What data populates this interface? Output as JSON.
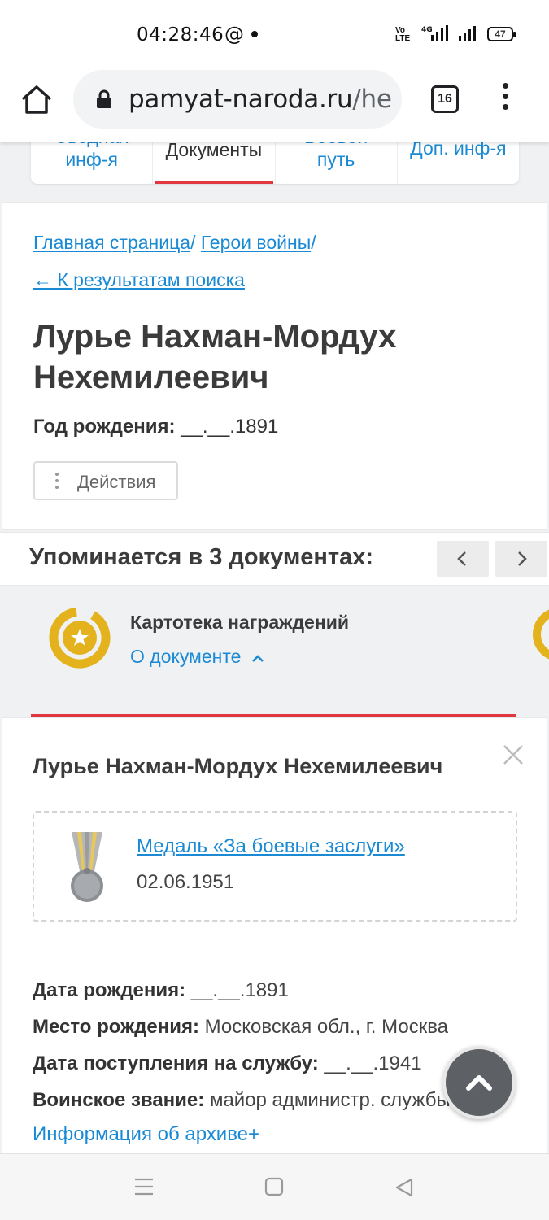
{
  "status": {
    "time": "04:28:46",
    "at_symbol": "@",
    "volte": "Vo\nLTE",
    "network": "4G",
    "battery": "47"
  },
  "browser": {
    "url_host": "pamyat-naroda.ru",
    "url_rest": "/he",
    "tab_count": "16"
  },
  "tabs": [
    {
      "line1": "Сводная",
      "line2": "инф-я"
    },
    {
      "label": "Документы"
    },
    {
      "line1": "Боевой",
      "line2": "путь"
    },
    {
      "label": "Доп. инф-я"
    }
  ],
  "breadcrumbs": {
    "home": "Главная страница",
    "heroes": "Герои войны",
    "separator": "/",
    "back": "← К результатам поиска"
  },
  "person": {
    "name": "Лурье Нахман-Мордух Нехемилеевич",
    "birth_label": "Год рождения:",
    "birth_value": "__.__.1891"
  },
  "actions_label": "Действия",
  "mentions": {
    "title": "Упоминается в 3 документах:"
  },
  "document": {
    "title": "Картотека награждений",
    "about": "О документе"
  },
  "record": {
    "name": "Лурье Нахман-Мордух Нехемилеевич",
    "award_name": "Медаль «За боевые заслуги»",
    "award_date": "02.06.1951",
    "facts": [
      {
        "label": "Дата рождения:",
        "value": "__.__.1891"
      },
      {
        "label": "Место рождения:",
        "value": "Московская обл., г. Москва"
      },
      {
        "label": "Дата поступления на службу:",
        "value": "__.__.1941"
      },
      {
        "label": "Воинское звание:",
        "value": "майор администр. службы"
      }
    ],
    "archive_link": "Информация об архиве+"
  },
  "colors": {
    "link": "#1a8ad4",
    "accent_red": "#e0383e",
    "gold": "#e3b21c"
  }
}
